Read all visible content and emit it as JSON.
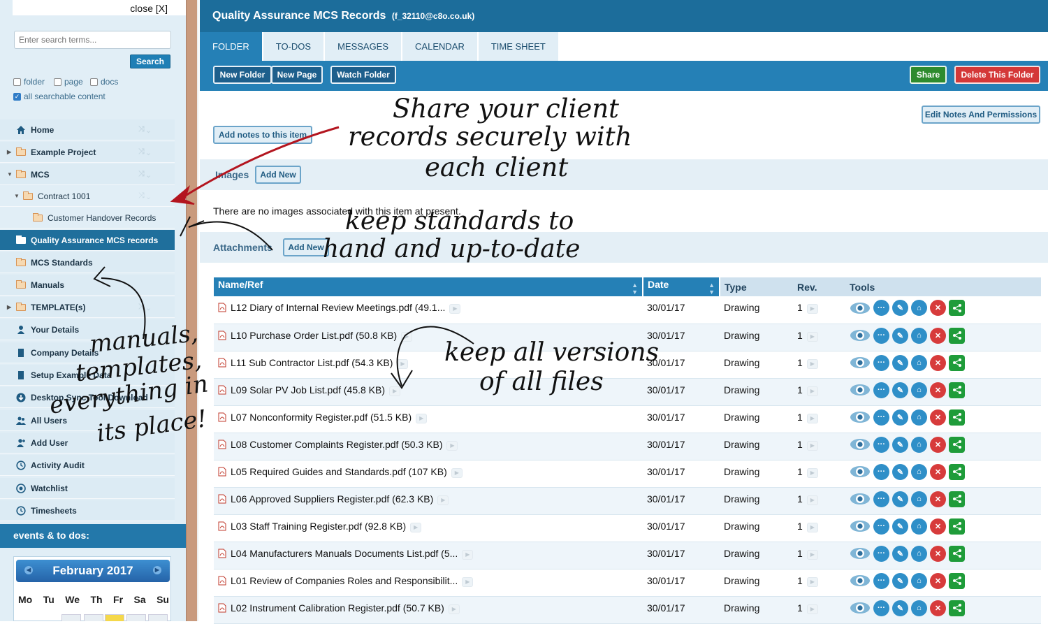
{
  "sidebar": {
    "close_label": "close [X]",
    "search_placeholder": "Enter search terms...",
    "search_button": "Search",
    "filters": [
      {
        "label": "folder",
        "checked": false
      },
      {
        "label": "page",
        "checked": false
      },
      {
        "label": "docs",
        "checked": false
      },
      {
        "label": "all searchable content",
        "checked": true
      }
    ],
    "nav": [
      {
        "label": "Home",
        "icon": "home-icon"
      },
      {
        "label": "Example Project",
        "icon": "folder-icon"
      },
      {
        "label": "MCS",
        "icon": "folder-icon"
      },
      {
        "label": "Contract 1001",
        "icon": "folder-icon"
      },
      {
        "label": "Customer Handover Records",
        "icon": "folder-icon"
      },
      {
        "label": "Quality Assurance MCS records",
        "icon": "open-folder-icon"
      },
      {
        "label": "MCS Standards",
        "icon": "folder-icon"
      },
      {
        "label": "Manuals",
        "icon": "folder-icon"
      },
      {
        "label": "TEMPLATE(s)",
        "icon": "folder-icon"
      },
      {
        "label": "Your Details",
        "icon": "user-icon"
      },
      {
        "label": "Company Details",
        "icon": "building-icon"
      },
      {
        "label": "Setup Example Data",
        "icon": "building-icon"
      },
      {
        "label": "Desktop Sync Tool Download",
        "icon": "download-icon"
      },
      {
        "label": "All Users",
        "icon": "users-icon"
      },
      {
        "label": "Add User",
        "icon": "add-user-icon"
      },
      {
        "label": "Activity Audit",
        "icon": "clock-icon"
      },
      {
        "label": "Watchlist",
        "icon": "eye-icon"
      },
      {
        "label": "Timesheets",
        "icon": "clock-icon"
      }
    ],
    "events_heading": "events & to dos:",
    "calendar": {
      "month": "February 2017",
      "days": [
        "Mo",
        "Tu",
        "We",
        "Th",
        "Fr",
        "Sa",
        "Su"
      ]
    }
  },
  "header": {
    "title": "Quality Assurance MCS Records",
    "email": "(f_32110@c8o.co.uk)"
  },
  "tabs": [
    "FOLDER",
    "TO-DOS",
    "MESSAGES",
    "CALENDAR",
    "TIME SHEET"
  ],
  "toolbar": {
    "new_folder": "New Folder",
    "new_page": "New Page",
    "watch_folder": "Watch Folder",
    "share": "Share",
    "delete_folder": "Delete This Folder"
  },
  "notes": {
    "edit_notes": "Edit Notes And Permissions",
    "add_notes": "Add notes to this item"
  },
  "images": {
    "heading": "Images",
    "add_new": "Add New",
    "empty_message": "There are no images associated with this item at present."
  },
  "attachments": {
    "heading": "Attachments",
    "add_new": "Add New",
    "columns": [
      "Name/Ref",
      "Date",
      "Type",
      "Rev.",
      "Tools"
    ],
    "rows": [
      {
        "name": "L12 Diary of Internal Review Meetings.pdf (49.1...",
        "date": "30/01/17",
        "type": "Drawing",
        "rev": "1"
      },
      {
        "name": "L10 Purchase Order List.pdf (50.8 KB)",
        "date": "30/01/17",
        "type": "Drawing",
        "rev": "1"
      },
      {
        "name": "L11 Sub Contractor List.pdf (54.3 KB)",
        "date": "30/01/17",
        "type": "Drawing",
        "rev": "1"
      },
      {
        "name": "L09 Solar PV Job List.pdf (45.8 KB)",
        "date": "30/01/17",
        "type": "Drawing",
        "rev": "1"
      },
      {
        "name": "L07 Nonconformity Register.pdf (51.5 KB)",
        "date": "30/01/17",
        "type": "Drawing",
        "rev": "1"
      },
      {
        "name": "L08 Customer Complaints Register.pdf (50.3 KB)",
        "date": "30/01/17",
        "type": "Drawing",
        "rev": "1"
      },
      {
        "name": "L05 Required Guides and Standards.pdf (107 KB)",
        "date": "30/01/17",
        "type": "Drawing",
        "rev": "1"
      },
      {
        "name": "L06 Approved Suppliers Register.pdf (62.3 KB)",
        "date": "30/01/17",
        "type": "Drawing",
        "rev": "1"
      },
      {
        "name": "L03 Staff Training Register.pdf (92.8 KB)",
        "date": "30/01/17",
        "type": "Drawing",
        "rev": "1"
      },
      {
        "name": "L04 Manufacturers Manuals Documents List.pdf (5...",
        "date": "30/01/17",
        "type": "Drawing",
        "rev": "1"
      },
      {
        "name": "L01 Review of Companies Roles and Responsibilit...",
        "date": "30/01/17",
        "type": "Drawing",
        "rev": "1"
      },
      {
        "name": "L02 Instrument Calibration Register.pdf (50.7 KB)",
        "date": "30/01/17",
        "type": "Drawing",
        "rev": "1"
      }
    ]
  },
  "annotations": {
    "share_line1": "Share your client",
    "share_line2": "records securely with",
    "share_line3": "each client",
    "standards_line1": "keep standards to",
    "standards_line2": "hand and up-to-date",
    "versions_line1": "keep all versions",
    "versions_line2": "of all files",
    "manuals_line1": "manuals,",
    "manuals_line2": "templates,",
    "manuals_line3": "everything in",
    "manuals_line4": "its place!"
  },
  "colors": {
    "brand_blue": "#1c6d9b",
    "tab_active": "#2580b6",
    "share_green": "#2e8b2e",
    "delete_red": "#d43838",
    "sidebar_bg": "#e1eef6"
  }
}
